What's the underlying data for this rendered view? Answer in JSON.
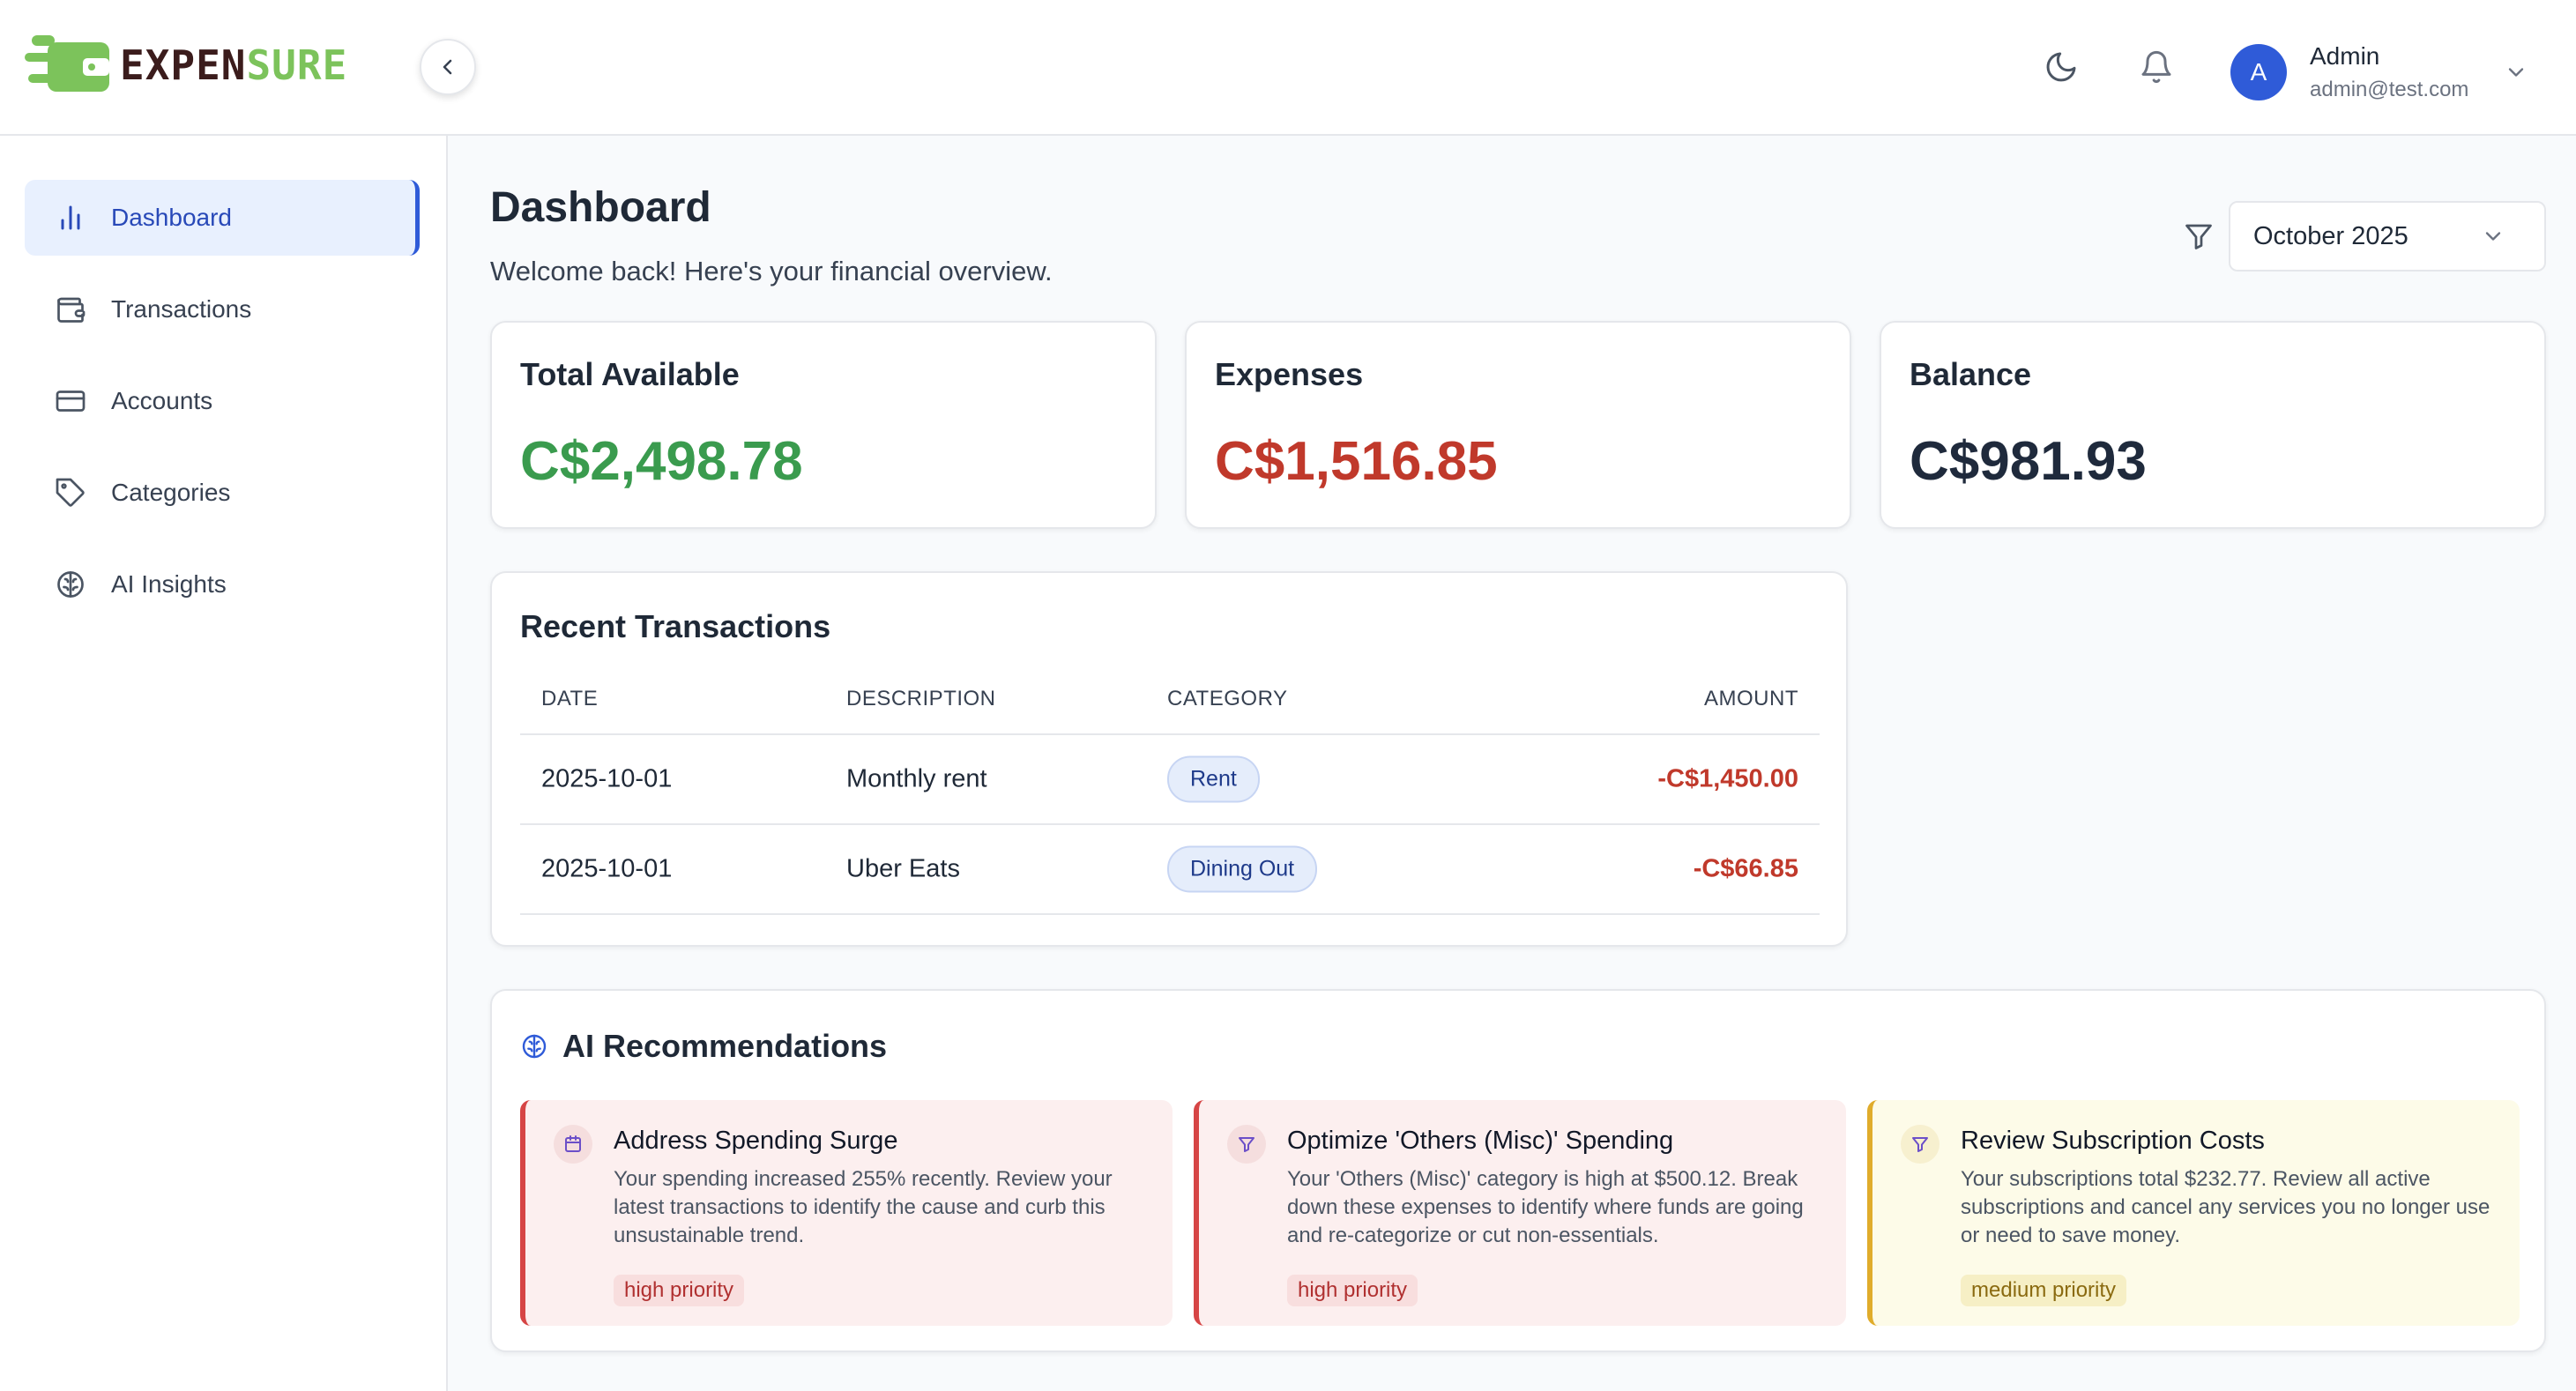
{
  "brand": {
    "name_part1": "EXPEN",
    "name_part2": "SURE"
  },
  "colors": {
    "brand_green": "#7cc35b",
    "accent_blue": "#2f5bd8",
    "positive": "#3a9b4e",
    "negative": "#c0392b",
    "neutral": "#1f2a3c"
  },
  "header": {
    "theme_icon": "moon-icon",
    "notifications_icon": "bell-icon",
    "user": {
      "initial": "A",
      "name": "Admin",
      "email": "admin@test.com"
    }
  },
  "sidebar": {
    "items": [
      {
        "label": "Dashboard",
        "icon": "bar-chart-icon",
        "active": true
      },
      {
        "label": "Transactions",
        "icon": "wallet-icon",
        "active": false
      },
      {
        "label": "Accounts",
        "icon": "credit-card-icon",
        "active": false
      },
      {
        "label": "Categories",
        "icon": "tag-icon",
        "active": false
      },
      {
        "label": "AI Insights",
        "icon": "brain-icon",
        "active": false
      }
    ]
  },
  "main": {
    "title": "Dashboard",
    "subtitle": "Welcome back! Here's your financial overview.",
    "month_filter": {
      "selected": "October 2025"
    },
    "stats": [
      {
        "label": "Total Available",
        "value": "C$2,498.78",
        "tone": "positive"
      },
      {
        "label": "Expenses",
        "value": "C$1,516.85",
        "tone": "negative"
      },
      {
        "label": "Balance",
        "value": "C$981.93",
        "tone": "neutral"
      }
    ],
    "recent_transactions": {
      "title": "Recent Transactions",
      "columns": [
        "DATE",
        "DESCRIPTION",
        "CATEGORY",
        "AMOUNT"
      ],
      "rows": [
        {
          "date": "2025-10-01",
          "description": "Monthly rent",
          "category": "Rent",
          "amount": "-C$1,450.00"
        },
        {
          "date": "2025-10-01",
          "description": "Uber Eats",
          "category": "Dining Out",
          "amount": "-C$66.85"
        }
      ]
    },
    "ai_recommendations": {
      "title": "AI Recommendations",
      "items": [
        {
          "title": "Address Spending Surge",
          "description": "Your spending increased 255% recently. Review your latest transactions to identify the cause and curb this unsustainable trend.",
          "priority": "high priority",
          "icon": "calendar-icon"
        },
        {
          "title": "Optimize 'Others (Misc)' Spending",
          "description": "Your 'Others (Misc)' category is high at $500.12. Break down these expenses to identify where funds are going and re-categorize or cut non-essentials.",
          "priority": "high priority",
          "icon": "funnel-icon"
        },
        {
          "title": "Review Subscription Costs",
          "description": "Your subscriptions total $232.77. Review all active subscriptions and cancel any services you no longer use or need to save money.",
          "priority": "medium priority",
          "icon": "funnel-icon"
        }
      ]
    }
  }
}
